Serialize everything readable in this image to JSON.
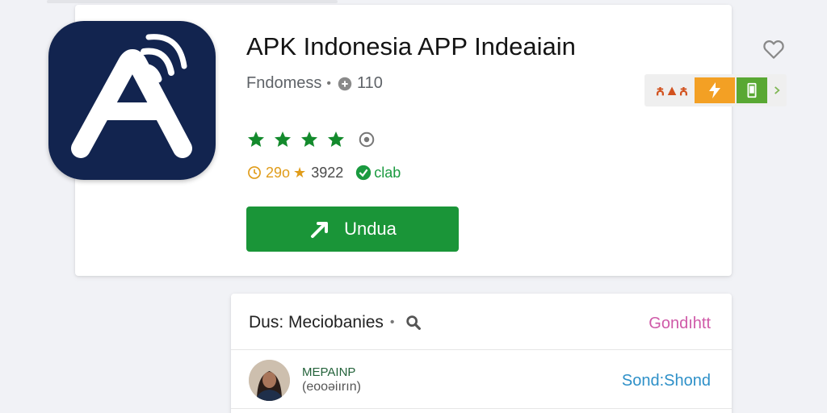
{
  "app": {
    "title": "APK Indonesia APP Indeaiain",
    "developer": "Fndomess",
    "download_count": "110",
    "rating_stars": 4,
    "rating_label": "29o",
    "review_count": "3922",
    "club_label": "clab",
    "install_label": "Undua"
  },
  "badges": {
    "first_label": "ꙉ▲ꙉ",
    "colors": [
      "#e06622",
      "#f3a024",
      "#59a833",
      "#7fb653"
    ]
  },
  "reviews": {
    "title": "Dus: Meciobanies",
    "link_label": "Gondıhtt",
    "reviewer": {
      "name": "MEPAINP",
      "sub": "(eooəiırın)",
      "action_label": "Sond:Shond"
    }
  },
  "colors": {
    "accent_green": "#1a9538",
    "star_green": "#138a2c",
    "icon_bg": "#12244f",
    "link_pink": "#cf5aa8",
    "link_blue": "#2e90c8"
  },
  "icons": [
    "app-logo",
    "heart-icon",
    "download-icon",
    "star-icon",
    "info-icon",
    "clock-icon",
    "club-icon",
    "install-arrow-icon",
    "search-icon"
  ]
}
